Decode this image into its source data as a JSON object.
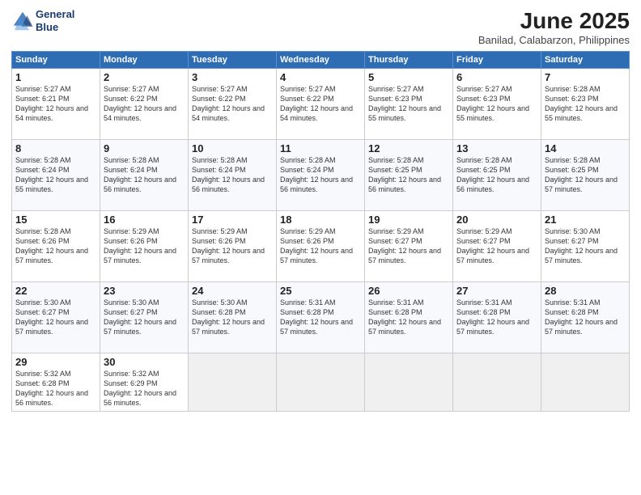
{
  "header": {
    "logo_line1": "General",
    "logo_line2": "Blue",
    "month": "June 2025",
    "location": "Banilad, Calabarzon, Philippines"
  },
  "weekdays": [
    "Sunday",
    "Monday",
    "Tuesday",
    "Wednesday",
    "Thursday",
    "Friday",
    "Saturday"
  ],
  "weeks": [
    [
      {
        "day": "1",
        "sunrise": "5:27 AM",
        "sunset": "6:21 PM",
        "daylight": "12 hours and 54 minutes."
      },
      {
        "day": "2",
        "sunrise": "5:27 AM",
        "sunset": "6:22 PM",
        "daylight": "12 hours and 54 minutes."
      },
      {
        "day": "3",
        "sunrise": "5:27 AM",
        "sunset": "6:22 PM",
        "daylight": "12 hours and 54 minutes."
      },
      {
        "day": "4",
        "sunrise": "5:27 AM",
        "sunset": "6:22 PM",
        "daylight": "12 hours and 54 minutes."
      },
      {
        "day": "5",
        "sunrise": "5:27 AM",
        "sunset": "6:23 PM",
        "daylight": "12 hours and 55 minutes."
      },
      {
        "day": "6",
        "sunrise": "5:27 AM",
        "sunset": "6:23 PM",
        "daylight": "12 hours and 55 minutes."
      },
      {
        "day": "7",
        "sunrise": "5:28 AM",
        "sunset": "6:23 PM",
        "daylight": "12 hours and 55 minutes."
      }
    ],
    [
      {
        "day": "8",
        "sunrise": "5:28 AM",
        "sunset": "6:24 PM",
        "daylight": "12 hours and 55 minutes."
      },
      {
        "day": "9",
        "sunrise": "5:28 AM",
        "sunset": "6:24 PM",
        "daylight": "12 hours and 56 minutes."
      },
      {
        "day": "10",
        "sunrise": "5:28 AM",
        "sunset": "6:24 PM",
        "daylight": "12 hours and 56 minutes."
      },
      {
        "day": "11",
        "sunrise": "5:28 AM",
        "sunset": "6:24 PM",
        "daylight": "12 hours and 56 minutes."
      },
      {
        "day": "12",
        "sunrise": "5:28 AM",
        "sunset": "6:25 PM",
        "daylight": "12 hours and 56 minutes."
      },
      {
        "day": "13",
        "sunrise": "5:28 AM",
        "sunset": "6:25 PM",
        "daylight": "12 hours and 56 minutes."
      },
      {
        "day": "14",
        "sunrise": "5:28 AM",
        "sunset": "6:25 PM",
        "daylight": "12 hours and 57 minutes."
      }
    ],
    [
      {
        "day": "15",
        "sunrise": "5:28 AM",
        "sunset": "6:26 PM",
        "daylight": "12 hours and 57 minutes."
      },
      {
        "day": "16",
        "sunrise": "5:29 AM",
        "sunset": "6:26 PM",
        "daylight": "12 hours and 57 minutes."
      },
      {
        "day": "17",
        "sunrise": "5:29 AM",
        "sunset": "6:26 PM",
        "daylight": "12 hours and 57 minutes."
      },
      {
        "day": "18",
        "sunrise": "5:29 AM",
        "sunset": "6:26 PM",
        "daylight": "12 hours and 57 minutes."
      },
      {
        "day": "19",
        "sunrise": "5:29 AM",
        "sunset": "6:27 PM",
        "daylight": "12 hours and 57 minutes."
      },
      {
        "day": "20",
        "sunrise": "5:29 AM",
        "sunset": "6:27 PM",
        "daylight": "12 hours and 57 minutes."
      },
      {
        "day": "21",
        "sunrise": "5:30 AM",
        "sunset": "6:27 PM",
        "daylight": "12 hours and 57 minutes."
      }
    ],
    [
      {
        "day": "22",
        "sunrise": "5:30 AM",
        "sunset": "6:27 PM",
        "daylight": "12 hours and 57 minutes."
      },
      {
        "day": "23",
        "sunrise": "5:30 AM",
        "sunset": "6:27 PM",
        "daylight": "12 hours and 57 minutes."
      },
      {
        "day": "24",
        "sunrise": "5:30 AM",
        "sunset": "6:28 PM",
        "daylight": "12 hours and 57 minutes."
      },
      {
        "day": "25",
        "sunrise": "5:31 AM",
        "sunset": "6:28 PM",
        "daylight": "12 hours and 57 minutes."
      },
      {
        "day": "26",
        "sunrise": "5:31 AM",
        "sunset": "6:28 PM",
        "daylight": "12 hours and 57 minutes."
      },
      {
        "day": "27",
        "sunrise": "5:31 AM",
        "sunset": "6:28 PM",
        "daylight": "12 hours and 57 minutes."
      },
      {
        "day": "28",
        "sunrise": "5:31 AM",
        "sunset": "6:28 PM",
        "daylight": "12 hours and 57 minutes."
      }
    ],
    [
      {
        "day": "29",
        "sunrise": "5:32 AM",
        "sunset": "6:28 PM",
        "daylight": "12 hours and 56 minutes."
      },
      {
        "day": "30",
        "sunrise": "5:32 AM",
        "sunset": "6:29 PM",
        "daylight": "12 hours and 56 minutes."
      },
      null,
      null,
      null,
      null,
      null
    ]
  ]
}
